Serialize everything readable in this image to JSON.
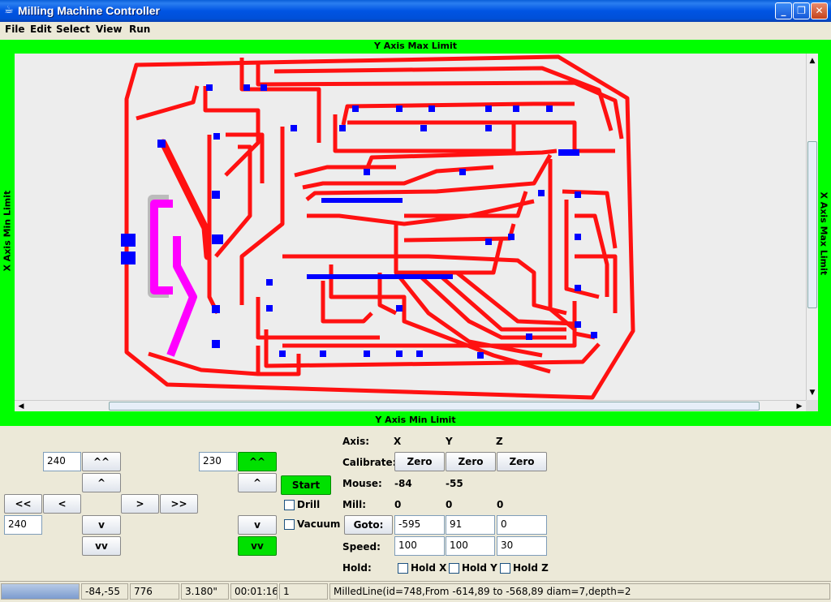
{
  "window": {
    "title": "Milling Machine Controller"
  },
  "menu": [
    "File",
    "Edit",
    "Select",
    "View",
    "Run"
  ],
  "limits": {
    "top": "Y Axis Max Limit",
    "bottom": "Y Axis Min Limit",
    "left": "X Axis Min Limit",
    "right": "X Axis Max Limit"
  },
  "jog": {
    "xy_step": "240",
    "x_step": "240",
    "z_step": "230",
    "up_fast": "^^",
    "up": "^",
    "left_fast": "<<",
    "left": "<",
    "right": ">",
    "right_fast": ">>",
    "down": "v",
    "down_fast": "vv",
    "z_up_fast": "^^",
    "z_up": "^",
    "z_down": "v",
    "z_down_fast": "vv"
  },
  "run": {
    "start": "Start",
    "drill": "Drill",
    "vacuum": "Vacuum"
  },
  "axes": {
    "axis_label": "Axis:",
    "x": "X",
    "y": "Y",
    "z": "Z",
    "calibrate_label": "Calibrate:",
    "zero": "Zero",
    "mouse_label": "Mouse:",
    "mouse_x": "-84",
    "mouse_y": "-55",
    "mill_label": "Mill:",
    "mill_x": "0",
    "mill_y": "0",
    "mill_z": "0",
    "goto": "Goto:",
    "goto_x": "-595",
    "goto_y": "91",
    "goto_z": "0",
    "speed_label": "Speed:",
    "speed_x": "100",
    "speed_y": "100",
    "speed_z": "30",
    "hold_label": "Hold:",
    "hold_x": "Hold X",
    "hold_y": "Hold Y",
    "hold_z": "Hold Z"
  },
  "status": {
    "coords": "-84,-55",
    "count": "776",
    "size": "3.180\"",
    "time": "00:01:16",
    "index": "1",
    "message": "MilledLine(id=748,From -614,89 to -568,89 diam=7,depth=2"
  },
  "colors": {
    "trace": "#ff1111",
    "pad": "#0000ff",
    "frame": "#00ff00",
    "highlight": "#ff00ff"
  }
}
